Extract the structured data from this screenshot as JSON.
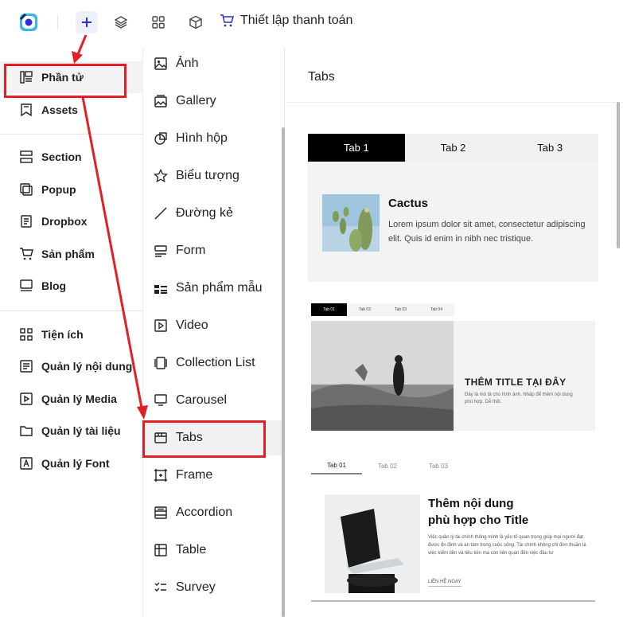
{
  "topbar": {
    "title": "Thiết lập thanh toán",
    "icons": [
      "app-logo",
      "plus-icon",
      "layers-icon",
      "grid-icon",
      "box-icon",
      "cart-icon"
    ]
  },
  "sidebar": {
    "group1": [
      {
        "label": "Phần tử",
        "icon": "elements-icon",
        "active": true
      },
      {
        "label": "Assets",
        "icon": "bookmark-icon"
      }
    ],
    "group2": [
      {
        "label": "Section",
        "icon": "section-icon"
      },
      {
        "label": "Popup",
        "icon": "popup-icon"
      },
      {
        "label": "Dropbox",
        "icon": "dropbox-icon"
      },
      {
        "label": "Sản phẩm",
        "icon": "cart-icon"
      },
      {
        "label": "Blog",
        "icon": "blog-icon"
      }
    ],
    "group3": [
      {
        "label": "Tiện ích",
        "icon": "widgets-icon"
      },
      {
        "label": "Quản lý nội dung",
        "icon": "content-icon"
      },
      {
        "label": "Quản lý Media",
        "icon": "media-icon"
      },
      {
        "label": "Quản lý tài liệu",
        "icon": "folder-icon"
      },
      {
        "label": "Quản lý Font",
        "icon": "font-icon"
      }
    ]
  },
  "elements": [
    {
      "label": "Ảnh",
      "icon": "image-icon"
    },
    {
      "label": "Gallery",
      "icon": "gallery-icon"
    },
    {
      "label": "Hình hộp",
      "icon": "shape-icon"
    },
    {
      "label": "Biểu tượng",
      "icon": "star-icon"
    },
    {
      "label": "Đường kẻ",
      "icon": "line-icon"
    },
    {
      "label": "Form",
      "icon": "form-icon"
    },
    {
      "label": "Sản phẩm mẫu",
      "icon": "product-sample-icon"
    },
    {
      "label": "Video",
      "icon": "video-icon"
    },
    {
      "label": "Collection List",
      "icon": "collection-icon"
    },
    {
      "label": "Carousel",
      "icon": "carousel-icon"
    },
    {
      "label": "Tabs",
      "icon": "tabs-icon",
      "active": true
    },
    {
      "label": "Frame",
      "icon": "frame-icon"
    },
    {
      "label": "Accordion",
      "icon": "accordion-icon"
    },
    {
      "label": "Table",
      "icon": "table-icon"
    },
    {
      "label": "Survey",
      "icon": "survey-icon"
    }
  ],
  "panel": {
    "title": "Tabs",
    "preview1": {
      "tabs": [
        "Tab 1",
        "Tab 2",
        "Tab 3"
      ],
      "heading": "Cactus",
      "text": "Lorem ipsum dolor sit amet, consectetur adipiscing elit. Quis id enim in nibh nec tristique."
    },
    "preview2": {
      "tabs": [
        "Tab 01",
        "Tab 02",
        "Tab 03",
        "Tab 04"
      ],
      "heading": "THÊM TITLE TẠI ĐÂY",
      "text": "Đây là mô tả cho hình ảnh. Nhấp để thêm nội dung phù hợp. Dễ thôi."
    },
    "preview3": {
      "tabs": [
        "Tab 01",
        "Tab 02",
        "Tab 03"
      ],
      "heading_line1": "Thêm nội dung",
      "heading_line2": "phù hợp cho Title",
      "text": "Việc quản lý tài chính thông minh là yếu tố quan trọng giúp mọi người đạt được ổn định và an tâm trong cuộc sống. Tài chính không chỉ đơn thuần là việc kiếm tiền và tiêu tiền mà còn liên quan đến việc đầu tư",
      "link": "LIÊN HỆ NGAY"
    }
  },
  "colors": {
    "accent": "#2b2fcf",
    "highlight": "#e21f26",
    "tab_selected": "#000000"
  }
}
